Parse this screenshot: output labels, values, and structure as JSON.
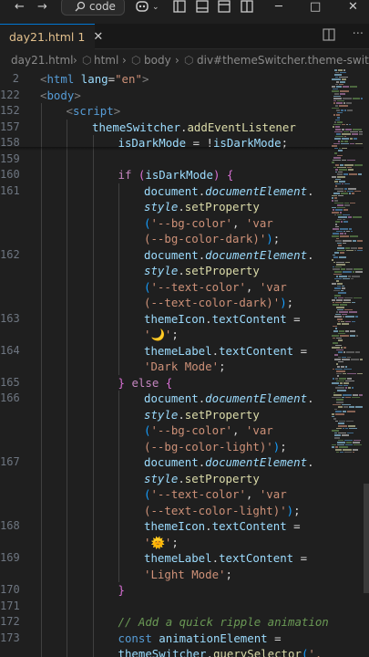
{
  "titlebar": {
    "back_icon": "arrow-left",
    "forward_icon": "arrow-right",
    "search_text": "code",
    "icons": [
      "copilot-icon",
      "chevron-down-icon",
      "layout-sidebar-icon",
      "layout-panel-icon",
      "layout-editor-icon",
      "layout-split-icon"
    ],
    "minimize": "─",
    "maximize": "□",
    "close": "✕"
  },
  "tab": {
    "name": "day21.html",
    "badge": "1",
    "close": "✕"
  },
  "breadcrumb": {
    "file": "day21.html",
    "items": [
      "html",
      "body",
      "div#themeSwitcher.theme-switcher"
    ]
  },
  "colors": {
    "background": "#1f1f1f",
    "accent": "#0078d4",
    "tag": "#569cd6",
    "string": "#ce9178",
    "variable": "#9cdcfe",
    "function": "#dcdcaa",
    "keyword": "#c586c0",
    "comment": "#6a9955"
  },
  "editor": {
    "lines": [
      {
        "n": "2",
        "tokens": [
          [
            "t-br",
            "<"
          ],
          [
            "t-tag",
            "html"
          ],
          [
            "t-pun",
            " "
          ],
          [
            "t-attr",
            "lang"
          ],
          [
            "t-pun",
            "="
          ],
          [
            "t-str",
            "\"en\""
          ],
          [
            "t-br",
            ">"
          ]
        ],
        "indent": 0
      },
      {
        "n": "122",
        "tokens": [
          [
            "t-br",
            "<"
          ],
          [
            "t-tag",
            "body"
          ],
          [
            "t-br",
            ">"
          ]
        ],
        "indent": 0
      },
      {
        "n": "152",
        "tokens": [
          [
            "t-br",
            "<"
          ],
          [
            "t-tag",
            "script"
          ],
          [
            "t-br",
            ">"
          ]
        ],
        "indent": 1
      },
      {
        "n": "157",
        "tokens": [
          [
            "t-var",
            "themeSwitcher"
          ],
          [
            "t-pun",
            "."
          ],
          [
            "t-fn",
            "addEventListener"
          ]
        ],
        "indent": 2
      },
      {
        "n": "158",
        "tokens": [
          [
            "t-var",
            "isDarkMode"
          ],
          [
            "t-pun",
            " = !"
          ],
          [
            "t-var",
            "isDarkMode"
          ],
          [
            "t-pun",
            ";"
          ]
        ],
        "indent": 3
      },
      {
        "n": "159",
        "tokens": [],
        "indent": 3
      },
      {
        "n": "160",
        "tokens": [
          [
            "t-kw",
            "if"
          ],
          [
            "t-pun",
            " "
          ],
          [
            "t-brace",
            "("
          ],
          [
            "t-var",
            "isDarkMode"
          ],
          [
            "t-brace",
            ")"
          ],
          [
            "t-pun",
            " "
          ],
          [
            "t-brace",
            "{"
          ]
        ],
        "indent": 3
      },
      {
        "n": "161",
        "tokens": [
          [
            "t-var",
            "document"
          ],
          [
            "t-pun",
            "."
          ],
          [
            "t-prop",
            "documentElement"
          ],
          [
            "t-pun",
            "."
          ]
        ],
        "indent": 4
      },
      {
        "n": "",
        "tokens": [
          [
            "t-prop",
            "style"
          ],
          [
            "t-pun",
            "."
          ],
          [
            "t-fn",
            "setProperty"
          ]
        ],
        "indent": 4
      },
      {
        "n": "",
        "tokens": [
          [
            "t-brace2",
            "("
          ],
          [
            "t-str",
            "'--bg-color'"
          ],
          [
            "t-pun",
            ", "
          ],
          [
            "t-str",
            "'var"
          ]
        ],
        "indent": 4
      },
      {
        "n": "",
        "tokens": [
          [
            "t-str",
            "(--bg-color-dark)'"
          ],
          [
            "t-brace2",
            ")"
          ],
          [
            "t-pun",
            ";"
          ]
        ],
        "indent": 4
      },
      {
        "n": "162",
        "tokens": [
          [
            "t-var",
            "document"
          ],
          [
            "t-pun",
            "."
          ],
          [
            "t-prop",
            "documentElement"
          ],
          [
            "t-pun",
            "."
          ]
        ],
        "indent": 4
      },
      {
        "n": "",
        "tokens": [
          [
            "t-prop",
            "style"
          ],
          [
            "t-pun",
            "."
          ],
          [
            "t-fn",
            "setProperty"
          ]
        ],
        "indent": 4
      },
      {
        "n": "",
        "tokens": [
          [
            "t-brace2",
            "("
          ],
          [
            "t-str",
            "'--text-color'"
          ],
          [
            "t-pun",
            ", "
          ],
          [
            "t-str",
            "'var"
          ]
        ],
        "indent": 4
      },
      {
        "n": "",
        "tokens": [
          [
            "t-str",
            "(--text-color-dark)'"
          ],
          [
            "t-brace2",
            ")"
          ],
          [
            "t-pun",
            ";"
          ]
        ],
        "indent": 4
      },
      {
        "n": "163",
        "tokens": [
          [
            "t-var",
            "themeIcon"
          ],
          [
            "t-pun",
            "."
          ],
          [
            "t-var",
            "textContent"
          ],
          [
            "t-pun",
            " ="
          ]
        ],
        "indent": 4
      },
      {
        "n": "",
        "tokens": [
          [
            "t-str",
            "'🌙'"
          ],
          [
            "t-pun",
            ";"
          ]
        ],
        "indent": 4
      },
      {
        "n": "164",
        "tokens": [
          [
            "t-var",
            "themeLabel"
          ],
          [
            "t-pun",
            "."
          ],
          [
            "t-var",
            "textContent"
          ],
          [
            "t-pun",
            " ="
          ]
        ],
        "indent": 4
      },
      {
        "n": "",
        "tokens": [
          [
            "t-str",
            "'Dark Mode'"
          ],
          [
            "t-pun",
            ";"
          ]
        ],
        "indent": 4
      },
      {
        "n": "165",
        "tokens": [
          [
            "t-brace",
            "}"
          ],
          [
            "t-pun",
            " "
          ],
          [
            "t-kw",
            "else"
          ],
          [
            "t-pun",
            " "
          ],
          [
            "t-brace",
            "{"
          ]
        ],
        "indent": 3
      },
      {
        "n": "166",
        "tokens": [
          [
            "t-var",
            "document"
          ],
          [
            "t-pun",
            "."
          ],
          [
            "t-prop",
            "documentElement"
          ],
          [
            "t-pun",
            "."
          ]
        ],
        "indent": 4
      },
      {
        "n": "",
        "tokens": [
          [
            "t-prop",
            "style"
          ],
          [
            "t-pun",
            "."
          ],
          [
            "t-fn",
            "setProperty"
          ]
        ],
        "indent": 4
      },
      {
        "n": "",
        "tokens": [
          [
            "t-brace2",
            "("
          ],
          [
            "t-str",
            "'--bg-color'"
          ],
          [
            "t-pun",
            ", "
          ],
          [
            "t-str",
            "'var"
          ]
        ],
        "indent": 4
      },
      {
        "n": "",
        "tokens": [
          [
            "t-str",
            "(--bg-color-light)'"
          ],
          [
            "t-brace2",
            ")"
          ],
          [
            "t-pun",
            ";"
          ]
        ],
        "indent": 4
      },
      {
        "n": "167",
        "tokens": [
          [
            "t-var",
            "document"
          ],
          [
            "t-pun",
            "."
          ],
          [
            "t-prop",
            "documentElement"
          ],
          [
            "t-pun",
            "."
          ]
        ],
        "indent": 4
      },
      {
        "n": "",
        "tokens": [
          [
            "t-prop",
            "style"
          ],
          [
            "t-pun",
            "."
          ],
          [
            "t-fn",
            "setProperty"
          ]
        ],
        "indent": 4
      },
      {
        "n": "",
        "tokens": [
          [
            "t-brace2",
            "("
          ],
          [
            "t-str",
            "'--text-color'"
          ],
          [
            "t-pun",
            ", "
          ],
          [
            "t-str",
            "'var"
          ]
        ],
        "indent": 4
      },
      {
        "n": "",
        "tokens": [
          [
            "t-str",
            "(--text-color-light)'"
          ],
          [
            "t-brace2",
            ")"
          ],
          [
            "t-pun",
            ";"
          ]
        ],
        "indent": 4
      },
      {
        "n": "168",
        "tokens": [
          [
            "t-var",
            "themeIcon"
          ],
          [
            "t-pun",
            "."
          ],
          [
            "t-var",
            "textContent"
          ],
          [
            "t-pun",
            " ="
          ]
        ],
        "indent": 4
      },
      {
        "n": "",
        "tokens": [
          [
            "t-str",
            "'🌞'"
          ],
          [
            "t-pun",
            ";"
          ]
        ],
        "indent": 4
      },
      {
        "n": "169",
        "tokens": [
          [
            "t-var",
            "themeLabel"
          ],
          [
            "t-pun",
            "."
          ],
          [
            "t-var",
            "textContent"
          ],
          [
            "t-pun",
            " ="
          ]
        ],
        "indent": 4
      },
      {
        "n": "",
        "tokens": [
          [
            "t-str",
            "'Light Mode'"
          ],
          [
            "t-pun",
            ";"
          ]
        ],
        "indent": 4
      },
      {
        "n": "170",
        "tokens": [
          [
            "t-brace",
            "}"
          ]
        ],
        "indent": 3
      },
      {
        "n": "171",
        "tokens": [],
        "indent": 3
      },
      {
        "n": "172",
        "tokens": [
          [
            "t-cmt",
            "// Add a quick ripple animation"
          ]
        ],
        "indent": 3
      },
      {
        "n": "173",
        "tokens": [
          [
            "t-kw2",
            "const"
          ],
          [
            "t-pun",
            " "
          ],
          [
            "t-var",
            "animationElement"
          ],
          [
            "t-pun",
            " ="
          ]
        ],
        "indent": 3
      },
      {
        "n": "",
        "tokens": [
          [
            "t-var",
            "themeSwitcher"
          ],
          [
            "t-pun",
            "."
          ],
          [
            "t-fn",
            "querySelector"
          ],
          [
            "t-brace2",
            "("
          ],
          [
            "t-str",
            "'."
          ]
        ],
        "indent": 3
      }
    ]
  }
}
